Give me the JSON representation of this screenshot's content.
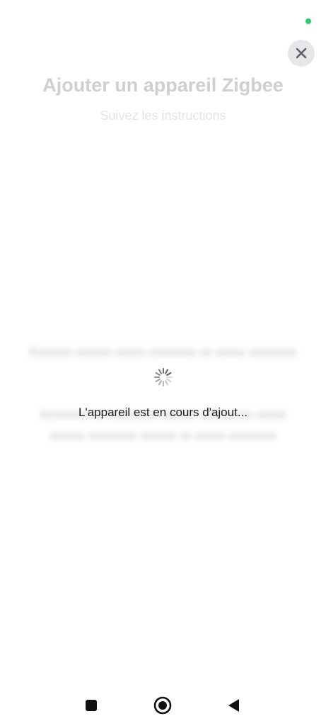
{
  "status": {
    "dot_color": "#2ecc71"
  },
  "header": {
    "title": "Ajouter un appareil Zigbee",
    "subtitle": "Suivez les instructions",
    "close_icon": "close-icon"
  },
  "loading": {
    "message": "L'appareil est en cours d'ajout...",
    "spinner_icon": "spinner-icon"
  },
  "nav_bar": {
    "recents_icon": "square-icon",
    "home_icon": "circle-icon",
    "back_icon": "triangle-back-icon"
  }
}
